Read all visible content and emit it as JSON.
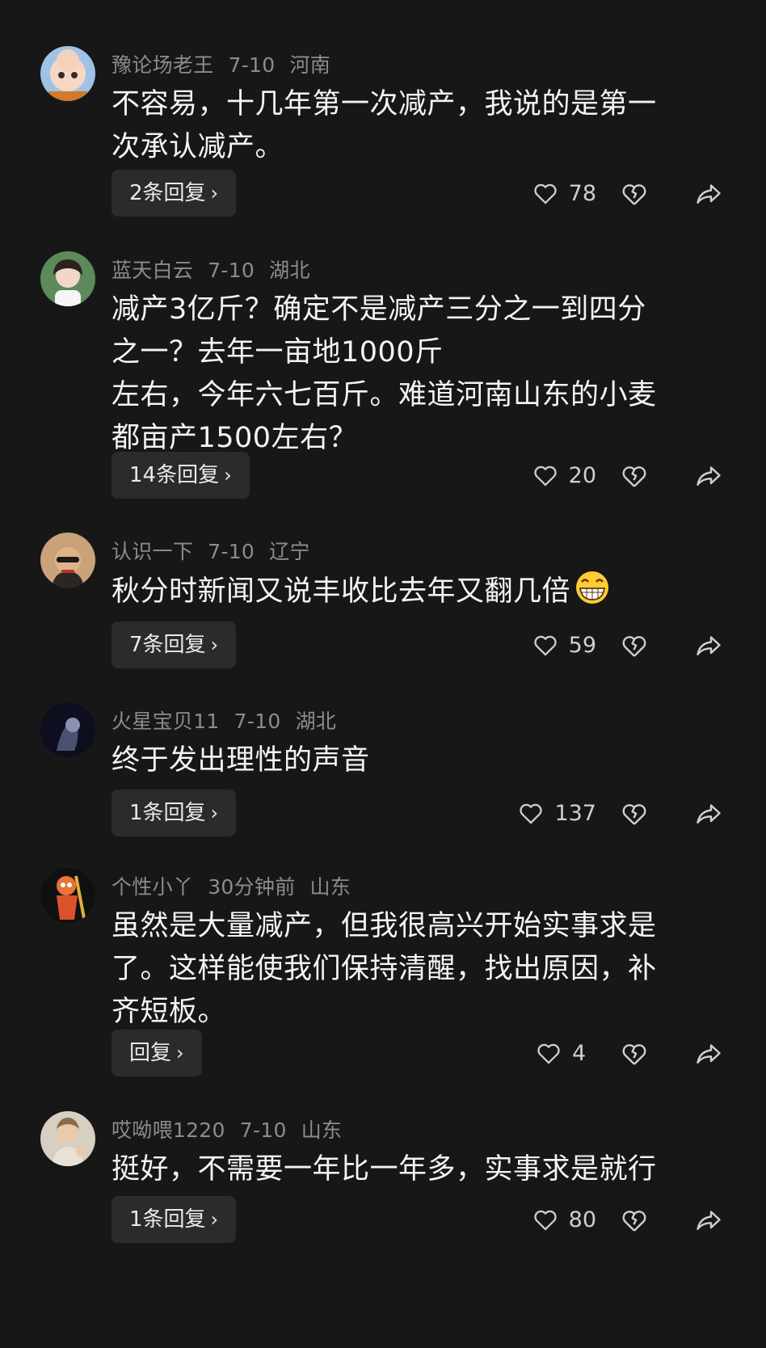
{
  "comments": [
    {
      "username": "豫论场老王",
      "date": "7-10",
      "location": "河南",
      "lines": [
        "不容易，十几年第一次减产，我说的是第一",
        "次承认减产。"
      ],
      "reply_label": "2条回复",
      "likes": "78"
    },
    {
      "username": "蓝天白云",
      "date": "7-10",
      "location": "湖北",
      "lines": [
        "减产3亿斤？确定不是减产三分之一到四分",
        "之一？去年一亩地1000斤",
        "左右，今年六七百斤。难道河南山东的小麦",
        "都亩产1500左右？"
      ],
      "reply_label": "14条回复",
      "likes": "20"
    },
    {
      "username": "认识一下",
      "date": "7-10",
      "location": "辽宁",
      "lines": [
        "秋分时新闻又说丰收比去年又翻几倍"
      ],
      "reply_label": "7条回复",
      "likes": "59"
    },
    {
      "username": "火星宝贝11",
      "date": "7-10",
      "location": "湖北",
      "lines": [
        "终于发出理性的声音"
      ],
      "reply_label": "1条回复",
      "likes": "137"
    },
    {
      "username": "个性小丫",
      "date": "30分钟前",
      "location": "山东",
      "lines": [
        "虽然是大量减产，但我很高兴开始实事求是",
        "了。这样能使我们保持清醒，找出原因，补",
        "齐短板。"
      ],
      "reply_label": "回复",
      "likes": "4"
    },
    {
      "username": "哎呦喂1220",
      "date": "7-10",
      "location": "山东",
      "lines": [
        "挺好，不需要一年比一年多，实事求是就行"
      ],
      "reply_label": "1条回复",
      "likes": "80"
    }
  ],
  "icons": {
    "reply_chevron": "chevron-right-icon",
    "like": "heart-outline-icon",
    "dislike": "broken-heart-icon",
    "share": "share-arrow-icon",
    "emoji": "grinning-face-emoji"
  },
  "colors": {
    "background": "#171718",
    "meta": "#8c8c8f",
    "text": "#f4f4f4",
    "reply_bg": "#2b2b2d"
  }
}
